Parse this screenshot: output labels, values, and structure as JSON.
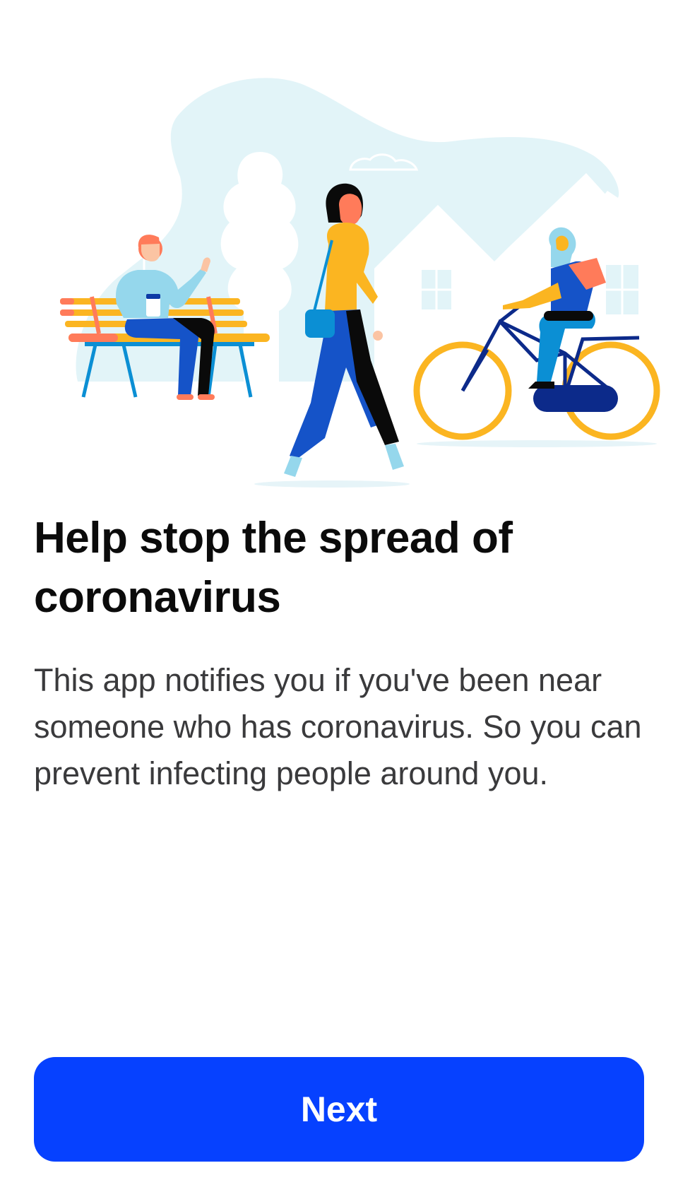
{
  "onboarding": {
    "title": "Help stop the spread of coronavirus",
    "description": "This app notifies you if you've been near someone who has coronavirus. So you can prevent infecting people around you.",
    "next_label": "Next"
  },
  "illustration": {
    "name": "people-outdoors-illustration"
  },
  "colors": {
    "accent": "#0641ff",
    "title": "#0b0b0b",
    "body": "#3a3a3c",
    "background": "#ffffff"
  }
}
